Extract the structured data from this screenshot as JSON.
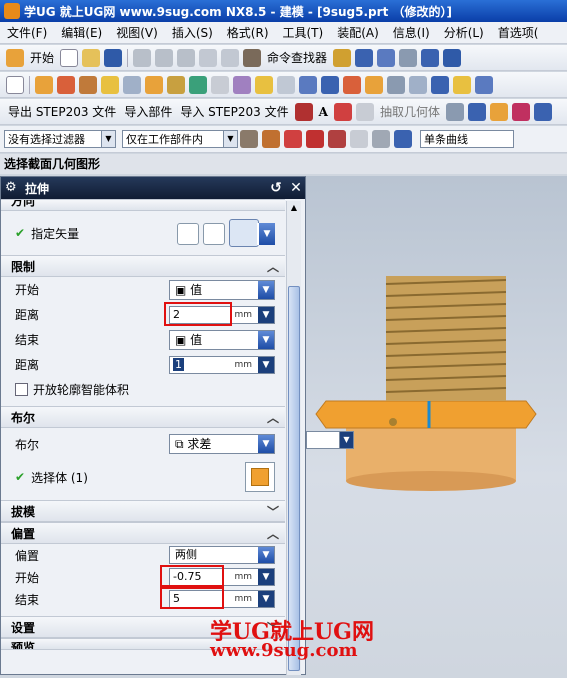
{
  "window": {
    "title": "学UG 就上UG网  www.9sug.com NX8.5 - 建模 - [9sug5.prt （修改的）]"
  },
  "menu": [
    "文件(F)",
    "编辑(E)",
    "视图(V)",
    "插入(S)",
    "格式(R)",
    "工具(T)",
    "装配(A)",
    "信息(I)",
    "分析(L)",
    "首选项("
  ],
  "toolbar1": {
    "start_label": "开始",
    "command_finder": "命令查找器"
  },
  "toolbar3": {
    "export_step": "导出 STEP203 文件",
    "import_part": "导入部件",
    "import_step": "导入 STEP203 文件",
    "extract_body": "抽取几何体"
  },
  "filter_bar": {
    "filter": "没有选择过滤器",
    "scope": "仅在工作部件内",
    "curve_rule": "单条曲线"
  },
  "status": "选择截面几何图形",
  "dialog": {
    "title": "拉伸",
    "direction_header": "方向",
    "specify_vector": "指定矢量",
    "limits_header": "限制",
    "start_label": "开始",
    "start_type": "值",
    "start_distance_label": "距离",
    "start_distance": "2",
    "end_label": "结束",
    "end_type": "值",
    "end_distance_label": "距离",
    "end_distance": "1",
    "unit": "mm",
    "open_profile": "开放轮廓智能体积",
    "boolean_header": "布尔",
    "boolean_label": "布尔",
    "boolean_value": "求差",
    "select_body": "选择体 (1)",
    "draft_header": "拔模",
    "offset_header": "偏置",
    "offset_label": "偏置",
    "offset_value": "两侧",
    "offset_start_label": "开始",
    "offset_start": "-0.75",
    "offset_end_label": "结束",
    "offset_end": "5",
    "settings_header": "设置",
    "preview_header": "预览"
  },
  "watermark": {
    "line1": "学UG就上UG网",
    "line2": "www.9sug.com"
  },
  "colors": {
    "part_orange": "#f0a030",
    "thread": "#c8a05a",
    "title_blue": "#0a3ea8"
  }
}
